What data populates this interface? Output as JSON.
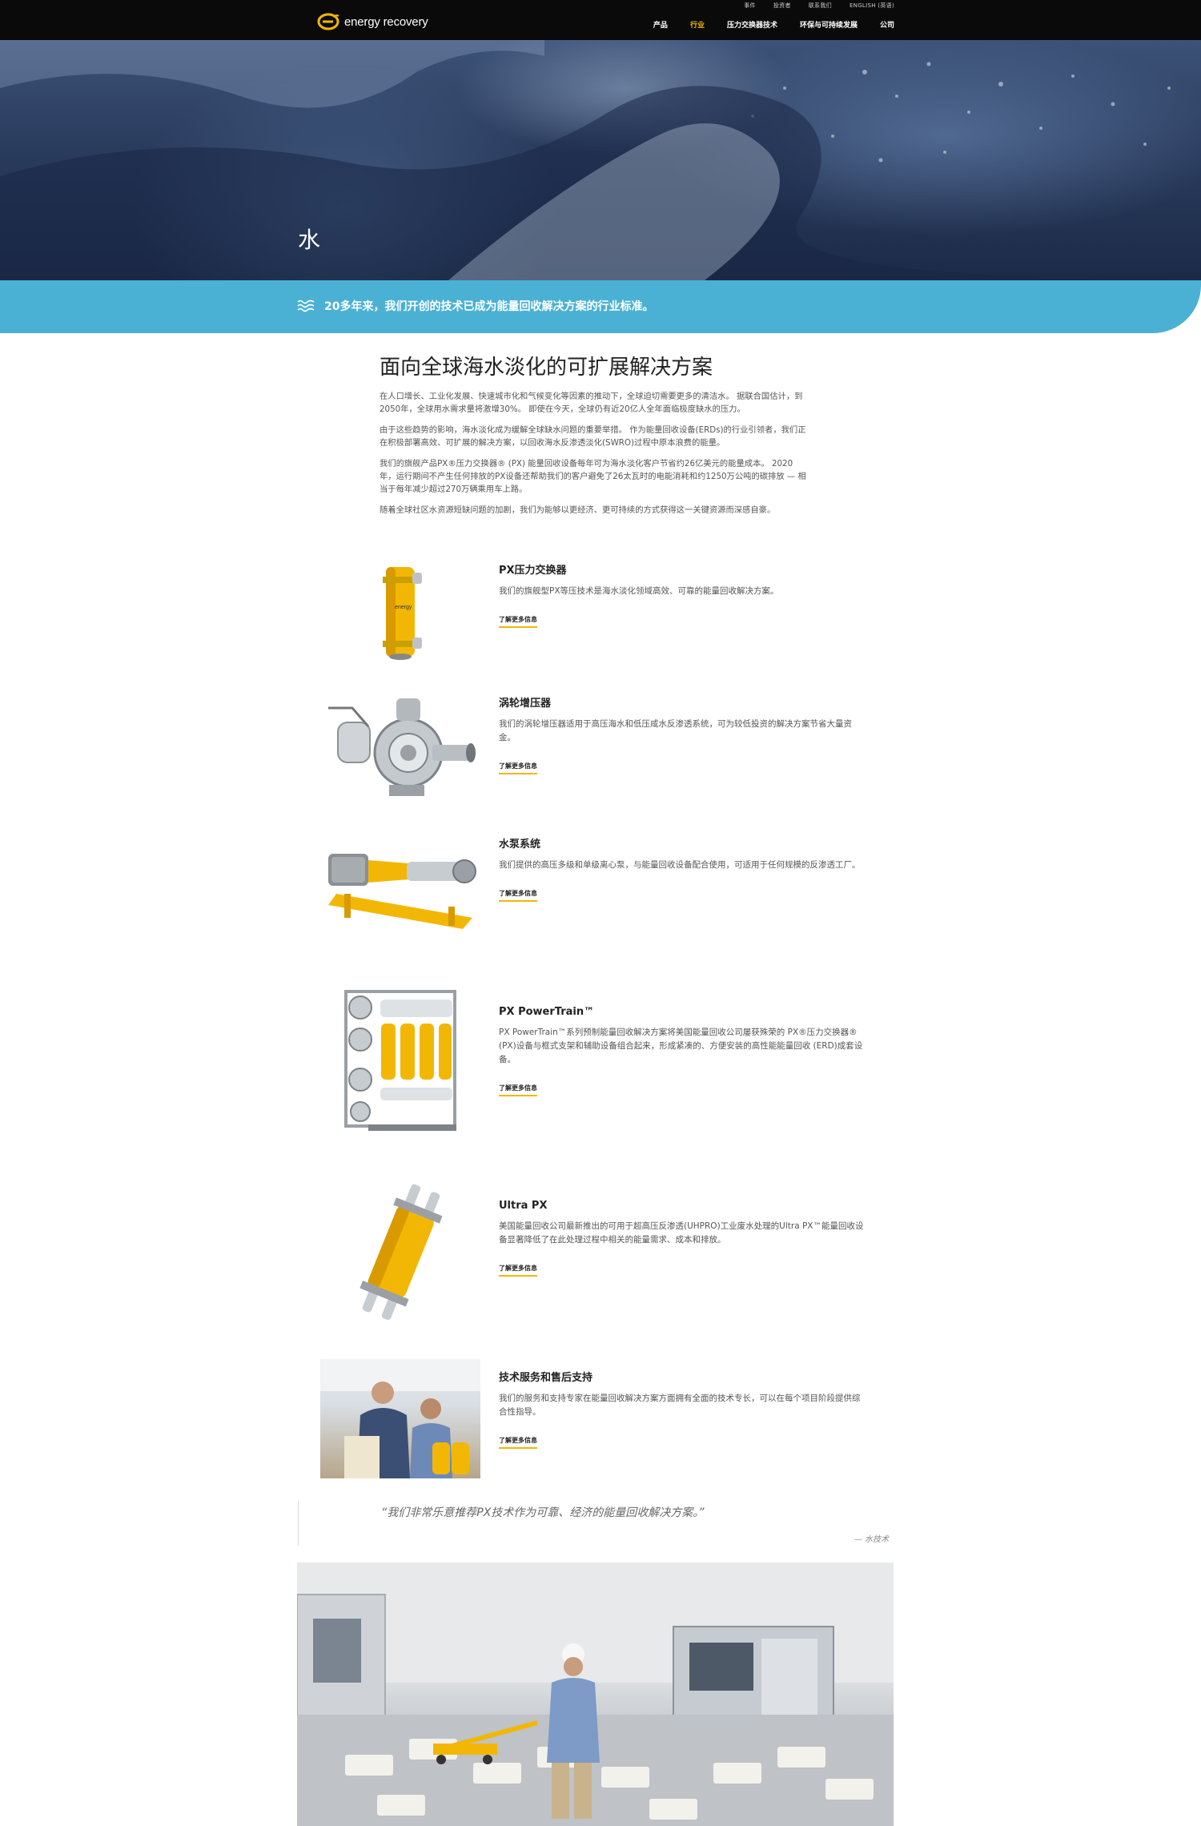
{
  "nav": {
    "utility_links": [
      "事件",
      "投资者",
      "联系我们",
      "ENGLISH (英语)"
    ],
    "logo_text": "energy recovery",
    "main_links": [
      "产品",
      "行业",
      "压力交换器技术",
      "环保与可持续发展",
      "公司"
    ],
    "active_link": "行业"
  },
  "hero": {
    "title": "水"
  },
  "banner": {
    "icon": "waves-icon",
    "text": "20多年来，我们开创的技术已成为能量回收解决方案的行业标准。"
  },
  "intro": {
    "heading": "面向全球海水淡化的可扩展解决方案",
    "paragraphs": [
      "在人口增长、工业化发展、快速城市化和气候变化等因素的推动下，全球迫切需要更多的清洁水。 据联合国估计，到2050年，全球用水需求量将激增30%。 即使在今天，全球仍有近20亿人全年面临极度缺水的压力。",
      "由于这些趋势的影响，海水淡化成为缓解全球缺水问题的重要举措。 作为能量回收设备(ERDs)的行业引领者，我们正在积极部署高效、可扩展的解决方案，以回收海水反渗透淡化(SWRO)过程中原本浪费的能量。",
      "我们的旗舰产品PX®压力交换器® (PX) 能量回收设备每年可为海水淡化客户节省约26亿美元的能量成本。 2020年，运行期间不产生任何排放的PX设备还帮助我们的客户避免了26太瓦时的电能消耗和约1250万公吨的碳排放 — 相当于每年减少超过270万辆乘用车上路。",
      "随着全球社区水资源短缺问题的加剧，我们为能够以更经济、更可持续的方式获得这一关键资源而深感自豪。"
    ]
  },
  "products": [
    {
      "title": "PX压力交换器",
      "desc": "我们的旗舰型PX等压技术是海水淡化领域高效、可靠的能量回收解决方案。",
      "link": "了解更多信息",
      "icon": "px-pressure-exchanger-image"
    },
    {
      "title": "涡轮增压器",
      "desc": "我们的涡轮增压器适用于高压海水和低压咸水反渗透系统，可为较低投资的解决方案节省大量资金。",
      "link": "了解更多信息",
      "icon": "turbocharger-image"
    },
    {
      "title": "水泵系统",
      "desc": "我们提供的高压多级和单级离心泵，与能量回收设备配合使用，可适用于任何规模的反渗透工厂。",
      "link": "了解更多信息",
      "icon": "pump-system-image"
    },
    {
      "title": "PX PowerTrain™",
      "desc": "PX PowerTrain™系列预制能量回收解决方案将美国能量回收公司屡获殊荣的 PX®压力交换器® (PX)设备与框式支架和辅助设备组合起来，形成紧凑的、方便安装的高性能能量回收 (ERD)成套设备。",
      "link": "了解更多信息",
      "icon": "powertrain-image"
    },
    {
      "title": "Ultra PX",
      "desc": "美国能量回收公司最新推出的可用于超高压反渗透(UHPRO)工业废水处理的Ultra PX™能量回收设备显著降低了在此处理过程中相关的能量需求、成本和排放。",
      "link": "了解更多信息",
      "icon": "ultra-px-image"
    },
    {
      "title": "技术服务和售后支持",
      "desc": "我们的服务和支持专家在能量回收解决方案方面拥有全面的技术专长，可以在每个项目阶段提供综合性指导。",
      "link": "了解更多信息",
      "icon": "service-photo"
    }
  ],
  "quote": {
    "text": "“我们非常乐意推荐PX技术作为可靠、经济的能量回收解决方案。”",
    "attribution": "— 水技术"
  },
  "colors": {
    "accent_yellow": "#f2b705",
    "banner_blue": "#4ab1d4",
    "nav_bg": "#0a0a0a"
  }
}
